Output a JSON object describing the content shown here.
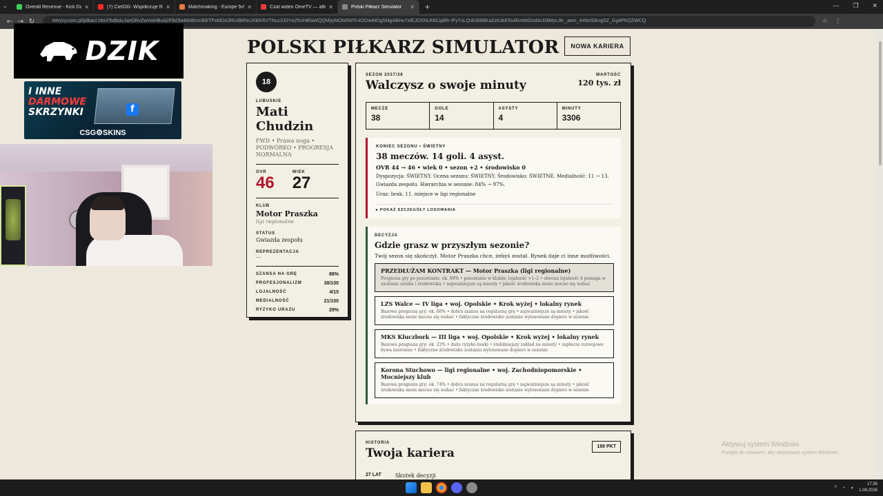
{
  "browser": {
    "tabs": [
      {
        "title": "Overall Revenue - Kick Dashbo",
        "fav": "#3ecf5a",
        "active": false
      },
      {
        "title": "(7) CieIOG- Współczuje Raperc",
        "fav": "#ff2b2b",
        "active": false
      },
      {
        "title": "Matchmaking - Europe 5v5 Qu",
        "fav": "#e9783b",
        "active": false
      },
      {
        "title": "Czat wideo OmeTV — alternat",
        "fav": "#e63b3b",
        "active": false
      },
      {
        "title": "Polski Piłkarz Simulator",
        "fav": "#888888",
        "active": true
      }
    ],
    "url": "tetrycy.com.pl/pilkarz.html?bdkdu.lwrGRvZwVwHBvA2FlbOlwMABicmlkETFsMDA3RUdMNnJXblV6VTNuc3J0YwZhcHBfaWQQMjIyMOM5MTc4ODIwMDg5MgABHu7xIEJOSNUk6CqdRr-lFyYsLQsk3688KaZzKzkE5s4EeWd2ndAcD8MycJ8-_aem_A49zIGkngSZ_Gg4PKQZWCQ"
  },
  "site": {
    "title": "POLSKI PIŁKARZ SIMULATOR",
    "new_career": "NOWA KARIERA"
  },
  "player": {
    "number": "18",
    "region": "LUBUSKIE",
    "first_name": "Mati",
    "last_name": "Chudzin",
    "meta": "FWD • Prawa noga • PODWÓRKO • PROGRESJA NORMALNA",
    "ovr_label": "OVR",
    "ovr": "46",
    "age_label": "WIEK",
    "age": "27",
    "club_label": "KLUB",
    "club": "Motor Praszka",
    "club_sub": "ligi regionalne",
    "status_label": "STATUS",
    "status": "Gwiazda zespołu",
    "rep_label": "REPREZENTACJA",
    "rep": "—",
    "meters": [
      {
        "label": "SZANSA NA GRĘ",
        "value": "88%"
      },
      {
        "label": "PROFESJONALIZM",
        "value": "38/100"
      },
      {
        "label": "LOJALNOŚĆ",
        "value": "4/15"
      },
      {
        "label": "MEDIALNOŚĆ",
        "value": "21/100"
      },
      {
        "label": "RYZYKO URAZU",
        "value": "29%"
      }
    ]
  },
  "season": {
    "label": "SEZON 2037/38",
    "headline": "Walczysz o swoje minuty",
    "worth_label": "WARTOŚĆ",
    "worth": "120 tys. zł",
    "stats": [
      {
        "label": "MECZE",
        "value": "38"
      },
      {
        "label": "GOLE",
        "value": "14"
      },
      {
        "label": "ASYSTY",
        "value": "4"
      },
      {
        "label": "MINUTY",
        "value": "3306"
      }
    ],
    "result": {
      "label": "KONIEC SEZONU • ŚWIETNY",
      "title": "38 meczów. 14 goli. 4 asyst.",
      "line1": "OVR 44 → 46 • wiek 0 • sezon +2 • środowisko 0",
      "desc": "Dyspozycja: ŚWIETNY. Ocena sezonu: ŚWIETNY. Środowisko: ŚWIETNE. Medialność: 11 → 13. Gwiazda zespołu. Hierarchia w sezonie: 84% → 97%.",
      "injury": "Uraz: brak. 11. miejsce w ligi regionalne",
      "toggle": "▸ POKAŻ SZCZEGÓŁY LOSOWANIA"
    },
    "decision": {
      "label": "DECYZJA",
      "title": "Gdzie grasz w przyszłym sezonie?",
      "intro": "Twój sezon się skończył. Motor Praszka chce, żebyś został. Rynek daje ci inne możliwości.",
      "options": [
        {
          "title": "PRZEDŁUŻAM KONTRAKT — Motor Praszka (ligi regionalne)",
          "desc": "Prognoza gry po pozostaniu: ok. 89% • pozostanie w klubie: lojalność +1–2 • obecna lojalność 4 pomaga w zaufaniu sztabu i środowiska • najważniejsze są minuty • jakość środowiska może mocno się wahać"
        },
        {
          "title": "LZS Walce — IV liga • woj. Opolskie • Krok wyżej • lokalny rynek",
          "desc": "Bazowa prognoza gry: ok. 66% • dobra szansa na regularną grę • najważniejsze są minuty • jakość środowiska może mocno się wahać • faktyczne środowisko zostanie wylosowane dopiero w sezonie"
        },
        {
          "title": "MKS Kluczbork — III liga • woj. Opolskie • Krok wyżej • lokalny rynek",
          "desc": "Bazowa prognoza gry: ok. 22% • duże ryzyko ławki • stabilniejszy zakład na minuty • zaplecze rozwojowe bywa nierówne • faktyczne środowisko zostanie wylosowane dopiero w sezonie"
        },
        {
          "title": "Korona Stuchowo — ligi regionalne • woj. Zachodniopomorskie • Mocniejszy klub",
          "desc": "Bazowa prognoza gry: ok. 74% • dobra szansa na regularną grę • najważniejsze są minuty • jakość środowiska może mocno się wahać • faktyczne środowisko zostanie wylosowane dopiero w sezonie"
        }
      ]
    }
  },
  "history": {
    "label": "HISTORIA",
    "title": "Twoja kariera",
    "points": "199 PKT",
    "row_age": "27 LAT",
    "row_text": "Skutek decyzji"
  },
  "watermark": {
    "line1": "Aktywuj system Windows",
    "line2": "Przejdź do ustawień, aby aktywować system Windows."
  },
  "overlay": {
    "logo": "DZIK",
    "promo_line1": "I INNE",
    "promo_line2": "DARMOWE",
    "promo_line3": "SKRZYNKI",
    "promo_brand": "CSG⚙SKINS"
  },
  "taskbar": {
    "time": "17:35",
    "date": "1.08.2026"
  }
}
